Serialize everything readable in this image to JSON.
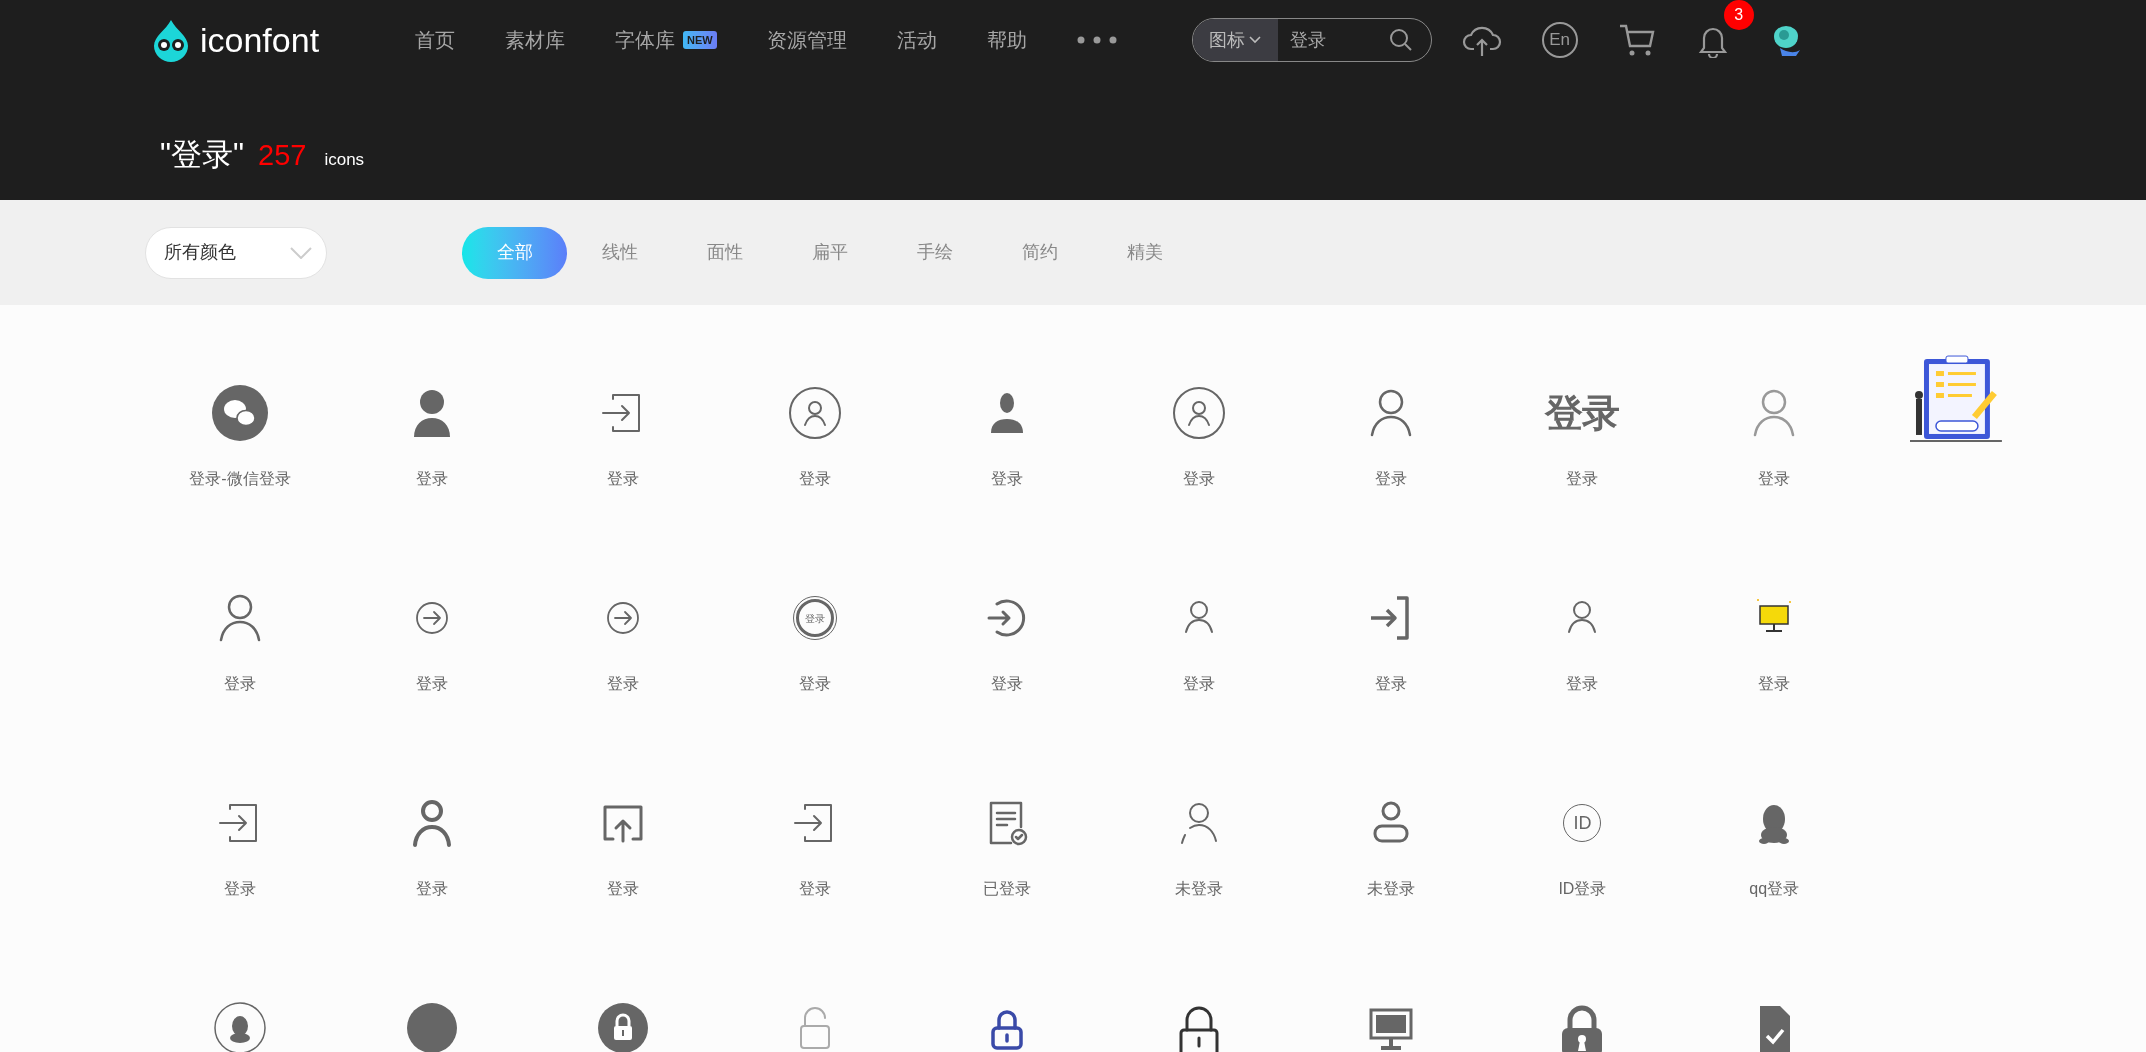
{
  "header": {
    "logo_text": "iconfont",
    "nav": [
      {
        "label": "首页"
      },
      {
        "label": "素材库"
      },
      {
        "label": "字体库",
        "badge": "NEW"
      },
      {
        "label": "资源管理"
      },
      {
        "label": "活动"
      },
      {
        "label": "帮助"
      }
    ],
    "search": {
      "scope": "图标",
      "value": "登录"
    },
    "language": "En",
    "notifications": "3"
  },
  "title": {
    "query": "\"登录\"",
    "count": "257",
    "unit": "icons"
  },
  "filters": {
    "color_select": "所有颜色",
    "tabs": [
      {
        "label": "全部",
        "selected": true
      },
      {
        "label": "线性",
        "selected": false
      },
      {
        "label": "面性",
        "selected": false
      },
      {
        "label": "扁平",
        "selected": false
      },
      {
        "label": "手绘",
        "selected": false
      },
      {
        "label": "简约",
        "selected": false
      },
      {
        "label": "精美",
        "selected": false
      }
    ]
  },
  "icons": [
    {
      "kind": "wechat",
      "color": "#666666",
      "label": "登录-微信登录"
    },
    {
      "kind": "person-solid",
      "color": "#666666",
      "label": "登录"
    },
    {
      "kind": "login-box",
      "color": "#666666",
      "label": "登录"
    },
    {
      "kind": "person-circle",
      "color": "#666666",
      "label": "登录"
    },
    {
      "kind": "person-bust",
      "color": "#666666",
      "label": "登录"
    },
    {
      "kind": "person-circle",
      "color": "#666666",
      "label": "登录"
    },
    {
      "kind": "person-outline",
      "color": "#666666",
      "label": "登录"
    },
    {
      "kind": "glyph",
      "color": "#666666",
      "glyph": "登录",
      "label": "登录"
    },
    {
      "kind": "person-outline",
      "color": "#999999",
      "label": "登录"
    },
    {
      "kind": "person-outline",
      "color": "#666666",
      "label": "登录"
    },
    {
      "kind": "arrow-circle",
      "color": "#666666",
      "label": "登录"
    },
    {
      "kind": "arrow-circle",
      "color": "#666666",
      "label": "登录"
    },
    {
      "kind": "seal",
      "color": "#666666",
      "glyph": "登录",
      "label": "登录"
    },
    {
      "kind": "arrow-circle-open",
      "color": "#666666",
      "label": "登录"
    },
    {
      "kind": "person-small",
      "color": "#666666",
      "label": "登录"
    },
    {
      "kind": "login-bracket",
      "color": "#666666",
      "label": "登录"
    },
    {
      "kind": "person-small",
      "color": "#666666",
      "label": "登录"
    },
    {
      "kind": "monitor-color",
      "color": "#f5d90a",
      "label": "登录"
    },
    {
      "kind": "login-box",
      "color": "#666666",
      "label": "登录"
    },
    {
      "kind": "person-thick",
      "color": "#666666",
      "label": "登录"
    },
    {
      "kind": "upload-box",
      "color": "#666666",
      "label": "登录"
    },
    {
      "kind": "login-box",
      "color": "#666666",
      "label": "登录"
    },
    {
      "kind": "document-check",
      "color": "#666666",
      "label": "已登录"
    },
    {
      "kind": "person-broken",
      "color": "#666666",
      "label": "未登录"
    },
    {
      "kind": "person-card",
      "color": "#666666",
      "label": "未登录"
    },
    {
      "kind": "circle-text",
      "color": "#666666",
      "glyph": "ID",
      "label": "ID登录"
    },
    {
      "kind": "penguin",
      "color": "#666666",
      "label": "qq登录"
    },
    {
      "kind": "penguin-circle",
      "color": "#666666"
    },
    {
      "kind": "disc",
      "color": "#666666"
    },
    {
      "kind": "lock-circle",
      "color": "#666666"
    },
    {
      "kind": "lock-open",
      "color": "#aaaaaa"
    },
    {
      "kind": "lock",
      "color": "#3a4aa8"
    },
    {
      "kind": "lock-tall",
      "color": "#333333"
    },
    {
      "kind": "monitor",
      "color": "#666666"
    },
    {
      "kind": "lock-keyhole",
      "color": "#666666"
    },
    {
      "kind": "file-check",
      "color": "#666666"
    }
  ]
}
